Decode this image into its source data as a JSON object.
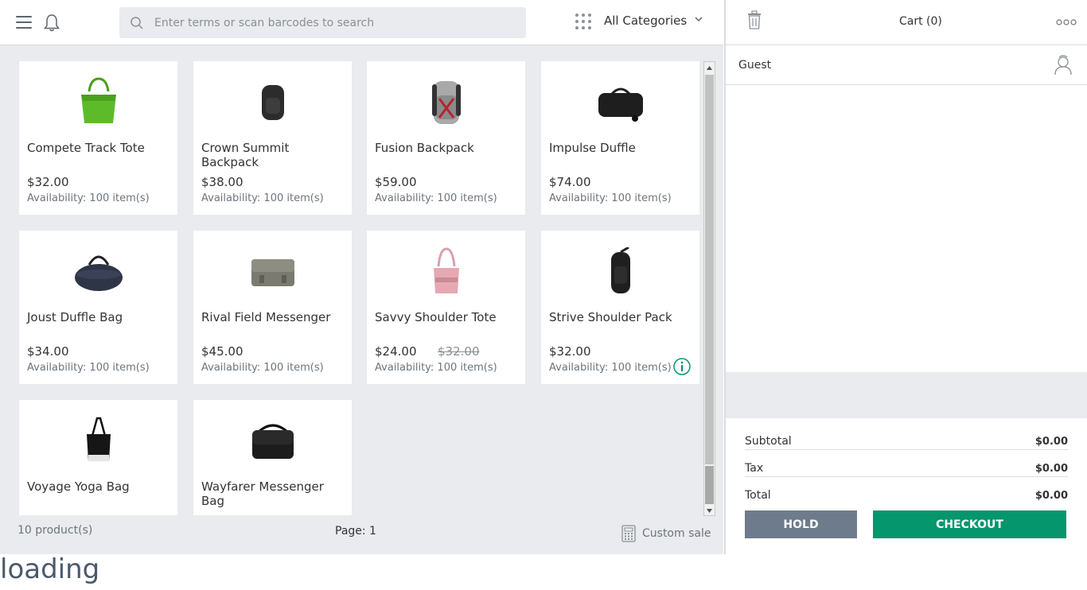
{
  "search": {
    "placeholder": "Enter terms or scan barcodes to search"
  },
  "categories": {
    "selected": "All Categories"
  },
  "products": [
    {
      "name": "Compete Track Tote",
      "price": "$32.00",
      "old_price": "",
      "availability": "Availability: 100 item(s)",
      "image": "green-tote"
    },
    {
      "name": "Crown Summit Backpack",
      "price": "$38.00",
      "old_price": "",
      "availability": "Availability: 100 item(s)",
      "image": "black-backpack"
    },
    {
      "name": "Fusion Backpack",
      "price": "$59.00",
      "old_price": "",
      "availability": "Availability: 100 item(s)",
      "image": "grey-red-backpack"
    },
    {
      "name": "Impulse Duffle",
      "price": "$74.00",
      "old_price": "",
      "availability": "Availability: 100 item(s)",
      "image": "black-duffle"
    },
    {
      "name": "Joust Duffle Bag",
      "price": "$34.00",
      "old_price": "",
      "availability": "Availability: 100 item(s)",
      "image": "navy-duffle"
    },
    {
      "name": "Rival Field Messenger",
      "price": "$45.00",
      "old_price": "",
      "availability": "Availability: 100 item(s)",
      "image": "grey-messenger"
    },
    {
      "name": "Savvy Shoulder Tote",
      "price": "$24.00",
      "old_price": "$32.00",
      "availability": "Availability: 100 item(s)",
      "image": "pink-tote"
    },
    {
      "name": "Strive Shoulder Pack",
      "price": "$32.00",
      "old_price": "",
      "availability": "Availability: 100 item(s)",
      "image": "black-sling"
    },
    {
      "name": "Voyage Yoga Bag",
      "price": "",
      "old_price": "",
      "availability": "",
      "image": "black-yoga-bag"
    },
    {
      "name": "Wayfarer Messenger Bag",
      "price": "",
      "old_price": "",
      "availability": "",
      "image": "black-messenger"
    }
  ],
  "footer": {
    "product_count": "10 product(s)",
    "page": "Page: 1",
    "custom_sale": "Custom sale"
  },
  "cart": {
    "title": "Cart (0)",
    "customer": "Guest",
    "subtotal_label": "Subtotal",
    "subtotal_value": "$0.00",
    "tax_label": "Tax",
    "tax_value": "$0.00",
    "total_label": "Total",
    "total_value": "$0.00",
    "hold_label": "HOLD",
    "checkout_label": "CHECKOUT"
  },
  "status": {
    "loading_text": "loading"
  },
  "colors": {
    "checkout": "#05966d",
    "hold": "#6d7b8c",
    "background": "#e9ebef",
    "info": "#05966d"
  }
}
